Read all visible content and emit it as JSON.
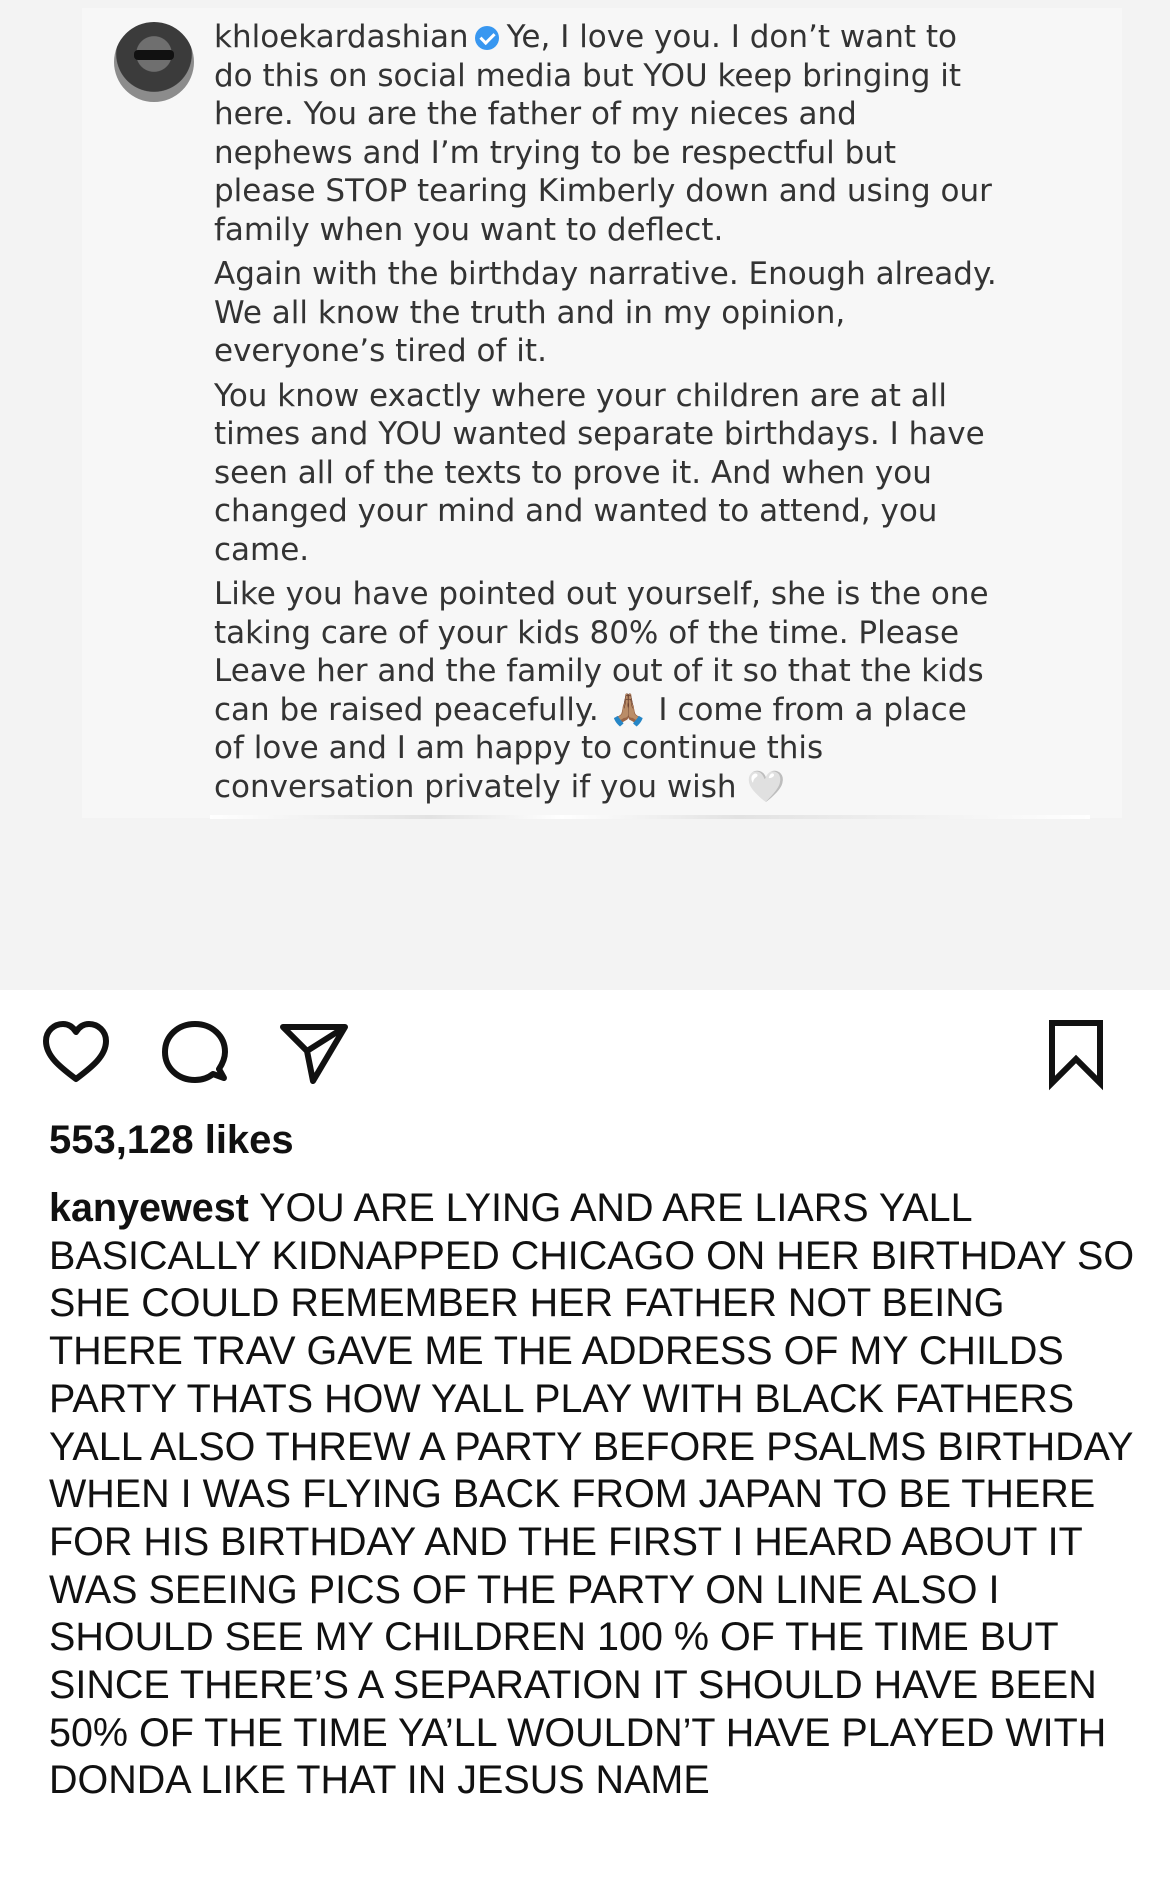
{
  "embedded_post": {
    "username": "khloekardashian",
    "verified": true,
    "paragraphs": [
      "Ye, I love you. I don’t want to do this on social media but YOU keep bringing it here. You are the father of my nieces and nephews and I’m trying to be respectful but please STOP tearing Kimberly down and using our family when you want to deflect.",
      "Again with the birthday narrative. Enough already. We all know the truth and in my opinion, everyone’s tired of it.",
      "You know exactly where your children are at all times and YOU wanted separate birthdays. I have seen all of the texts to prove it. And when you changed your mind and wanted to attend, you came."
    ],
    "last_paragraph_before_emoji": "Like you have pointed out yourself, she is the one taking care of your kids 80% of the time. Please Leave her and the family out of it so that the kids can be raised peacefully.",
    "pray_emoji": "🙏🏽",
    "last_paragraph_after_emoji": "I come from a place of love and I am happy to continue this conversation privately if you wish",
    "heart_emoji": "🤍"
  },
  "actions": {
    "like_icon": "heart-outline-icon",
    "comment_icon": "speech-bubble-icon",
    "share_icon": "paper-plane-icon",
    "save_icon": "bookmark-outline-icon"
  },
  "likes": "553,128 likes",
  "caption": {
    "username": "kanyewest",
    "text": "YOU ARE LYING AND ARE LIARS  YALL BASICALLY KIDNAPPED CHICAGO ON HER BIRTHDAY SO SHE COULD REMEMBER HER FATHER NOT BEING THERE TRAV GAVE ME THE ADDRESS OF MY CHILDS PARTY THATS HOW YALL PLAY WITH BLACK FATHERS YALL ALSO THREW A PARTY BEFORE PSALMS BIRTHDAY WHEN I WAS FLYING BACK FROM JAPAN TO BE THERE FOR HIS BIRTHDAY AND THE FIRST I HEARD ABOUT IT WAS SEEING PICS OF THE PARTY ON LINE  ALSO I SHOULD SEE MY CHILDREN 100 % OF THE TIME BUT SINCE THERE’S A SEPARATION IT SHOULD HAVE BEEN 50% OF THE TIME  YA’LL WOULDN’T HAVE PLAYED WITH DONDA LIKE THAT IN JESUS NAME"
  },
  "colors": {
    "verified": "#3897f0",
    "text": "#111111",
    "embedded_text": "#333333"
  }
}
